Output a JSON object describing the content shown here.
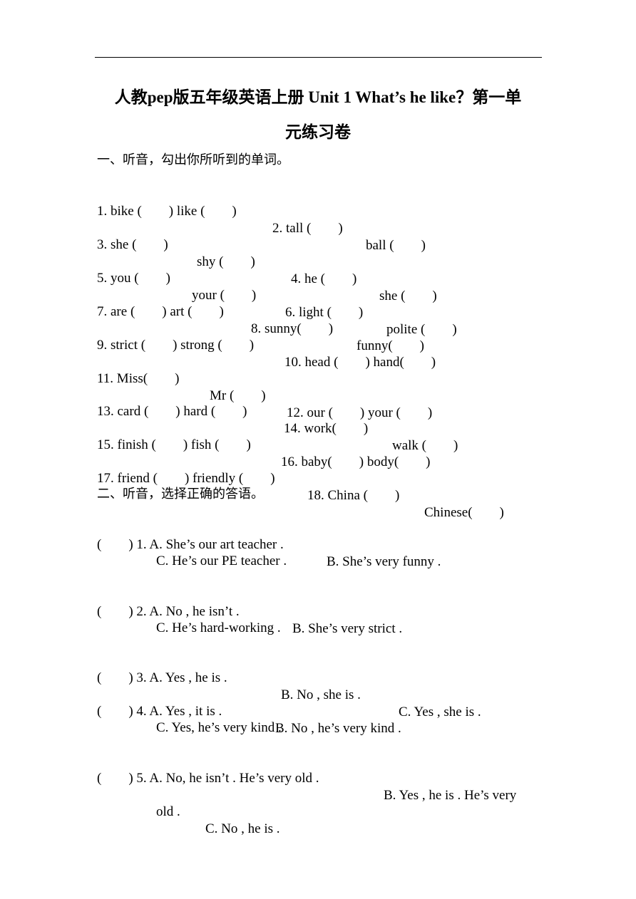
{
  "document": {
    "title_line1": "人教pep版五年级英语上册 Unit 1 What’s he like？第一单",
    "title_line2": "元练习卷",
    "section1": {
      "heading": "一、听音，勾出你所听到的单词。",
      "rows": [
        [
          "1. bike (        ) like (        )",
          "2. tall (        )",
          "ball (        )"
        ],
        [
          "3. she (        )",
          "shy (        )",
          "4. he (        )",
          "she (        )"
        ],
        [
          "5. you (        )",
          "your (        )",
          "6. light (        )",
          "polite (        )"
        ],
        [
          "7. are (        ) art (        )",
          "8. sunny(        )",
          "funny(        )"
        ],
        [
          "9. strict (        ) strong (        )",
          "10. head (        ) hand(        )"
        ],
        [
          "11. Miss(        )",
          "Mr (        )",
          "12. our (        ) your (        )"
        ],
        [
          "13. card (        ) hard (        )",
          "14. work(        )",
          "walk (        )"
        ],
        [
          "15. finish (        ) fish (        )",
          "16. baby(        ) body(        )"
        ],
        [
          "17. friend (        ) friendly (        )",
          "18. China (        )",
          "Chinese(        )"
        ]
      ]
    },
    "section2": {
      "heading": "二、听音，选择正确的答语。",
      "questions": [
        {
          "lead": "(        ) 1. A. She’s our art teacher .",
          "b": "B. She’s very funny .",
          "c": "C. He’s our PE teacher ."
        },
        {
          "lead": "(        ) 2. A. No , he isn’t .",
          "b": "B. She’s very strict .",
          "c": "C. He’s hard-working ."
        },
        {
          "lead": "(        ) 3. A. Yes , he is .",
          "b": "B. No , she is .",
          "c": "C. Yes , she is ."
        },
        {
          "lead": "(        ) 4. A. Yes , it is .",
          "b": "B. No , he’s very kind .",
          "c": "C. Yes, he’s very kind ."
        },
        {
          "lead": "(        ) 5. A. No, he isn’t . He’s very old .",
          "b": "B. Yes , he is . He’s very",
          "c": "old .",
          "d": "C. No , he is ."
        }
      ]
    }
  }
}
